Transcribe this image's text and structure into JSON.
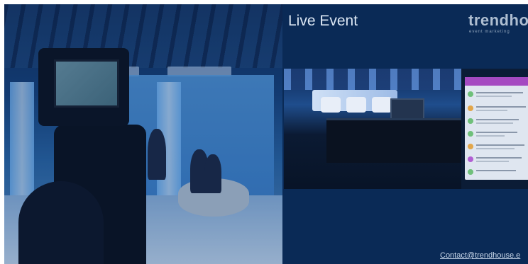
{
  "event": {
    "title": "Live Event"
  },
  "brand": {
    "name": "trendhou",
    "tagline": "event marketing"
  },
  "footer": {
    "contact": "Contact@trendhouse.e"
  },
  "colors": {
    "panel_background": "#0a2a56",
    "chat_header": "#a54ac1",
    "chat_avatar_green": "#6fc07a",
    "chat_avatar_orange": "#e2a64a",
    "chat_avatar_purple": "#b15fd3"
  }
}
